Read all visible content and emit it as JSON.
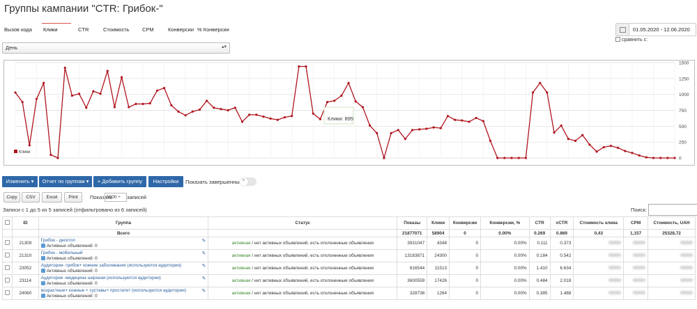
{
  "page_title": "Группы кампании \"CTR: Грибок-\"",
  "tabs": [
    "Вызов кода",
    "Клики",
    "CTR",
    "Стоимость",
    "CPM",
    "Конверсии",
    "% Конверсии"
  ],
  "active_tab": "Клики",
  "date_range": "01.05.2020 - 12.06.2020",
  "compare_label": "сравнить с:",
  "period": "День",
  "chart_data": {
    "type": "line",
    "series": [
      {
        "name": "Клики",
        "color": "#b0141e",
        "values": [
          1030,
          880,
          200,
          930,
          1180,
          50,
          0,
          1420,
          980,
          1010,
          790,
          1050,
          1010,
          1370,
          800,
          1270,
          800,
          850,
          850,
          860,
          1060,
          1100,
          830,
          730,
          670,
          730,
          760,
          900,
          790,
          770,
          750,
          790,
          570,
          680,
          680,
          650,
          620,
          600,
          640,
          660,
          1440,
          1440,
          700,
          610,
          880,
          900,
          980,
          1180,
          890,
          800,
          510,
          390,
          0,
          390,
          440,
          300,
          440,
          450,
          460,
          480,
          470,
          660,
          600,
          590,
          570,
          630,
          580,
          270,
          0,
          0,
          0,
          0,
          0,
          1030,
          1180,
          1030,
          400,
          510,
          300,
          270,
          360,
          210,
          100,
          170,
          190,
          160,
          110,
          80,
          40,
          10,
          0,
          0,
          0,
          0
        ],
        "tooltip": "Клики: 895"
      }
    ],
    "y_ticks": [
      0,
      250,
      500,
      750,
      1000,
      1250,
      1500
    ],
    "ylim": [
      0,
      1500
    ],
    "grid": true,
    "legend": "bottom-left"
  },
  "buttons": {
    "change": "Изменить ▾",
    "report": "Отчет по группам ▾",
    "add_group": "+ Добавить группу",
    "settings": "Настройки",
    "show_finished": "Показать завершенные"
  },
  "export": {
    "copy": "Copy",
    "csv": "CSV",
    "excel": "Excel",
    "print": "Print",
    "show": "Показать",
    "page_size": "5000 ÷",
    "records": "записей"
  },
  "info": "Записи с 1 до 5 из 5 записей (отфильтровано из 6 записей)",
  "search_label": "Поиск:",
  "table": {
    "headers": [
      "ID",
      "Группа",
      "Статус",
      "Показы",
      "Клики",
      "Конверсии",
      "Конверсии, %",
      "CTR",
      "vCTR",
      "Стоимость клика",
      "CPM",
      "Стоимость, UAH"
    ],
    "total": {
      "label": "Всего",
      "shows": "21877071",
      "clicks": "58904",
      "conv": "0",
      "conv_pct": "0.00%",
      "ctr": "0.269",
      "vctr": "0.869",
      "cpc": "0,43",
      "cpm": "1,157",
      "cost": "25328,72"
    },
    "active_ads_label": "Активных объявлений: 0",
    "rows": [
      {
        "id": "21309",
        "name": "Грибок - десктоп",
        "status_active": "активная",
        "status_rest": " / нет активных объявлений, есть отклоненные объявления",
        "shows": "3931047",
        "clicks": "4348",
        "conv": "0",
        "conv_pct": "0.00%",
        "ctr": "0.111",
        "vctr": "0.373"
      },
      {
        "id": "21310",
        "name": "Грибок - мобильный",
        "status_active": "активная",
        "status_rest": " / нет активных объявлений, есть отклоненные объявления",
        "shows": "13183871",
        "clicks": "24300",
        "conv": "0",
        "conv_pct": "0.00%",
        "ctr": "0.184",
        "vctr": "0.542"
      },
      {
        "id": "23052",
        "name": "Аудитории- грибок+ кожние заболевания (используются аудитории)",
        "status_active": "активная",
        "status_rest": " / нет активных объявлений, есть отклоненные объявления",
        "shows": "816544",
        "clicks": "11513",
        "conv": "0",
        "conv_pct": "0.00%",
        "ctr": "1.410",
        "vctr": "6.634"
      },
      {
        "id": "23114",
        "name": "Аудитории -медицина широкая (используются аудитории)",
        "status_active": "активная",
        "status_rest": " / нет активных объявлений, есть отклоненные объявления",
        "shows": "3600559",
        "clicks": "17426",
        "conv": "0",
        "conv_pct": "0.00%",
        "ctr": "0.484",
        "vctr": "2.018"
      },
      {
        "id": "24060",
        "name": "возрастные+ кожные + суставы+ простатит (используются аудитории)",
        "status_active": "активная",
        "status_rest": " / нет активных объявлений, есть отклоненные объявления",
        "shows": "328738",
        "clicks": "1264",
        "conv": "0",
        "conv_pct": "0.00%",
        "ctr": "0.385",
        "vctr": "1.488"
      }
    ]
  }
}
